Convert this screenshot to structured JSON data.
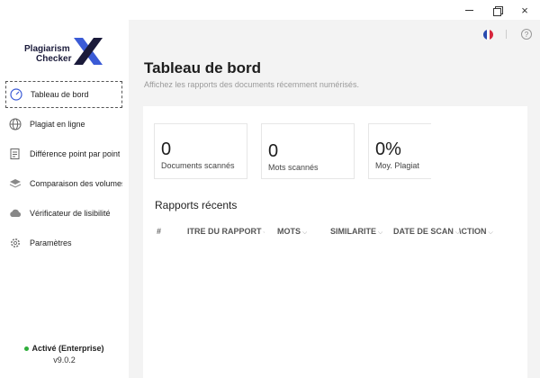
{
  "window": {
    "minimize": "minimize",
    "maximize": "restore",
    "close": "×"
  },
  "logo": {
    "line1": "Plagiarism",
    "line2": "Checker",
    "mark": "X",
    "colors": {
      "dark": "#1a1a3a",
      "blue": "#3b5bd6"
    }
  },
  "sidebar": {
    "items": [
      {
        "label": "Tableau de bord",
        "icon": "gauge-icon",
        "active": true
      },
      {
        "label": "Plagiat en ligne",
        "icon": "globe-icon",
        "active": false
      },
      {
        "label": "Différence point par point",
        "icon": "document-compare-icon",
        "active": false
      },
      {
        "label": "Comparaison des volumes",
        "icon": "layers-icon",
        "active": false
      },
      {
        "label": "Vérificateur de lisibilité",
        "icon": "cloud-icon",
        "active": false
      },
      {
        "label": "Paramètres",
        "icon": "gear-icon",
        "active": false
      }
    ],
    "status": "Activé (Enterprise)",
    "version": "v9.0.2",
    "status_color": "#2fae3b"
  },
  "header": {
    "language_flag": "flag-france-icon",
    "help": "?"
  },
  "page": {
    "title": "Tableau de bord",
    "subtitle": "Affichez les rapports des documents récemment numérisés."
  },
  "stats": [
    {
      "value": "0",
      "label": "Documents scannés"
    },
    {
      "value": "0",
      "label": "Mots scannés"
    },
    {
      "value": "0%",
      "label": "Moy. Plagiat"
    }
  ],
  "reports": {
    "title": "Rapports récents",
    "columns": [
      {
        "label": "#",
        "sortable": false
      },
      {
        "label": "ITRE DU RAPPORT",
        "sortable": true
      },
      {
        "label": "MOTS",
        "sortable": true
      },
      {
        "label": "SIMILARITE",
        "sortable": true
      },
      {
        "label": "DATE DE SCAN",
        "sortable": true
      },
      {
        "label": "\\CTION",
        "sortable": true
      }
    ],
    "rows": []
  }
}
